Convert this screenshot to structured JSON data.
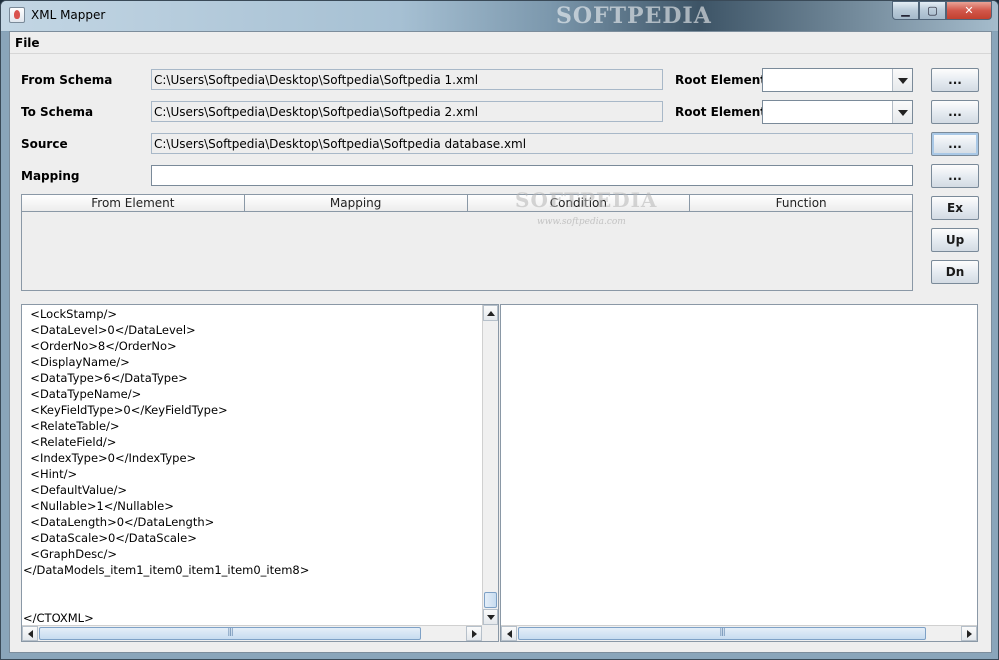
{
  "window": {
    "title": "XML Mapper",
    "watermark": "SOFTPEDIA",
    "controls": {
      "minimize": "▁",
      "maximize": "▢",
      "close": "✕"
    }
  },
  "menu": {
    "file": "File"
  },
  "form": {
    "from_schema": {
      "label": "From Schema",
      "value": "C:\\Users\\Softpedia\\Desktop\\Softpedia\\Softpedia 1.xml",
      "root_label": "Root Element",
      "root_value": ""
    },
    "to_schema": {
      "label": "To Schema",
      "value": "C:\\Users\\Softpedia\\Desktop\\Softpedia\\Softpedia 2.xml",
      "root_label": "Root Element",
      "root_value": ""
    },
    "source": {
      "label": "Source",
      "value": "C:\\Users\\Softpedia\\Desktop\\Softpedia\\Softpedia database.xml"
    },
    "mapping": {
      "label": "Mapping",
      "value": ""
    }
  },
  "buttons": {
    "browse": "...",
    "ex": "Ex",
    "up": "Up",
    "dn": "Dn"
  },
  "table": {
    "columns": [
      "From Element",
      "Mapping",
      "Condition",
      "Function"
    ]
  },
  "watermark_center": {
    "main": "SOFTPEDIA",
    "sub": "www.softpedia.com"
  },
  "xml_lines": [
    "  <LockStamp/>",
    "  <DataLevel>0</DataLevel>",
    "  <OrderNo>8</OrderNo>",
    "  <DisplayName/>",
    "  <DataType>6</DataType>",
    "  <DataTypeName/>",
    "  <KeyFieldType>0</KeyFieldType>",
    "  <RelateTable/>",
    "  <RelateField/>",
    "  <IndexType>0</IndexType>",
    "  <Hint/>",
    "  <DefaultValue/>",
    "  <Nullable>1</Nullable>",
    "  <DataLength>0</DataLength>",
    "  <DataScale>0</DataScale>",
    "  <GraphDesc/>",
    "</DataModels_item1_item0_item1_item0_item8>",
    "",
    "",
    "</CTOXML>"
  ]
}
